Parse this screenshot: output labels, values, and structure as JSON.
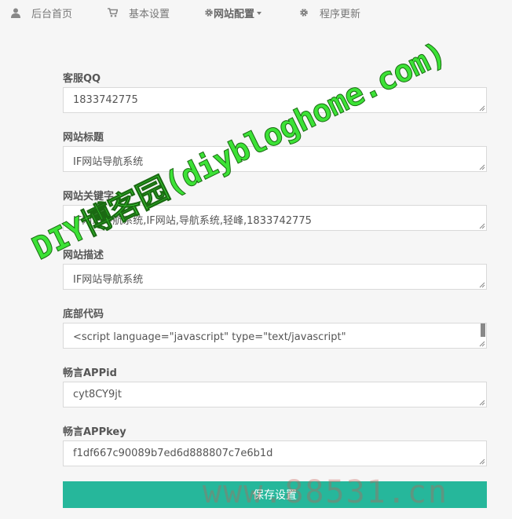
{
  "nav": {
    "items": [
      {
        "label": "后台首页",
        "icon": "user-icon"
      },
      {
        "label": "基本设置",
        "icon": "cart-icon"
      },
      {
        "label": "网站配置",
        "icon": "gear-icon",
        "active": true
      },
      {
        "label": "程序更新",
        "icon": "gear-icon"
      }
    ]
  },
  "form": {
    "qq": {
      "label": "客服QQ",
      "value": "1833742775"
    },
    "title": {
      "label": "网站标题",
      "value": "IF网站导航系统"
    },
    "keywords": {
      "label": "网站关键字",
      "value": "IF网站导航系统,IF网站,导航系统,轻峰,1833742775"
    },
    "description": {
      "label": "网站描述",
      "value": "IF网站导航系统"
    },
    "footer": {
      "label": "底部代码",
      "value": "<script language=\"javascript\" type=\"text/javascript\""
    },
    "appid": {
      "label": "畅言APPid",
      "value": "cyt8CY9jt"
    },
    "appkey": {
      "label": "畅言APPkey",
      "value": "f1df667c90089b7ed6d888807c7e6b1d"
    }
  },
  "save_label": "保存设置",
  "watermarks": {
    "diagonal": "DIY博客园(diybloghome.com)",
    "bottom": "www.88531.cn"
  }
}
